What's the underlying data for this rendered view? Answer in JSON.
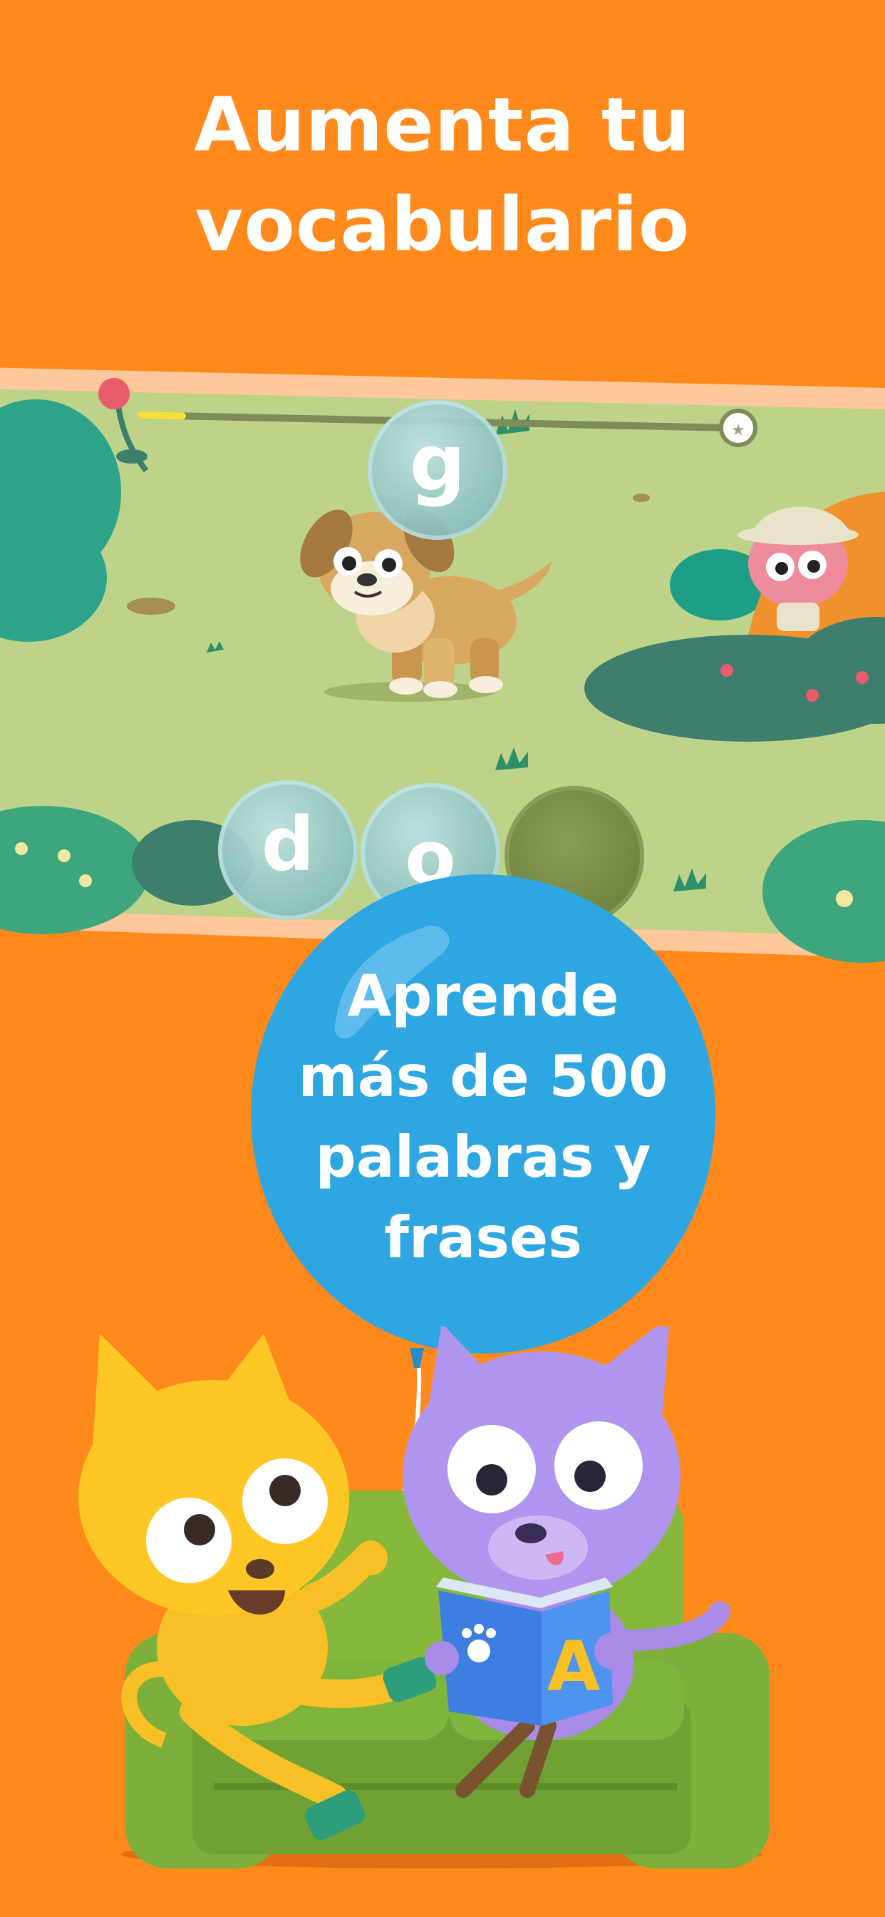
{
  "header": {
    "line1": "Aumenta tu",
    "line2": "vocabulario"
  },
  "game": {
    "target_letter": "g",
    "spelled_letters": [
      "d",
      "o"
    ],
    "progress": 0.07
  },
  "balloon": {
    "line1": "Aprende",
    "line2": "más de 500",
    "line3": "palabras y",
    "line4": "frases"
  },
  "book": {
    "letter": "A"
  },
  "colors": {
    "background": "#FF8A1B",
    "balloon": "#2DA6E2",
    "grass": "#BCD389",
    "panel_border": "#FFC89A"
  }
}
